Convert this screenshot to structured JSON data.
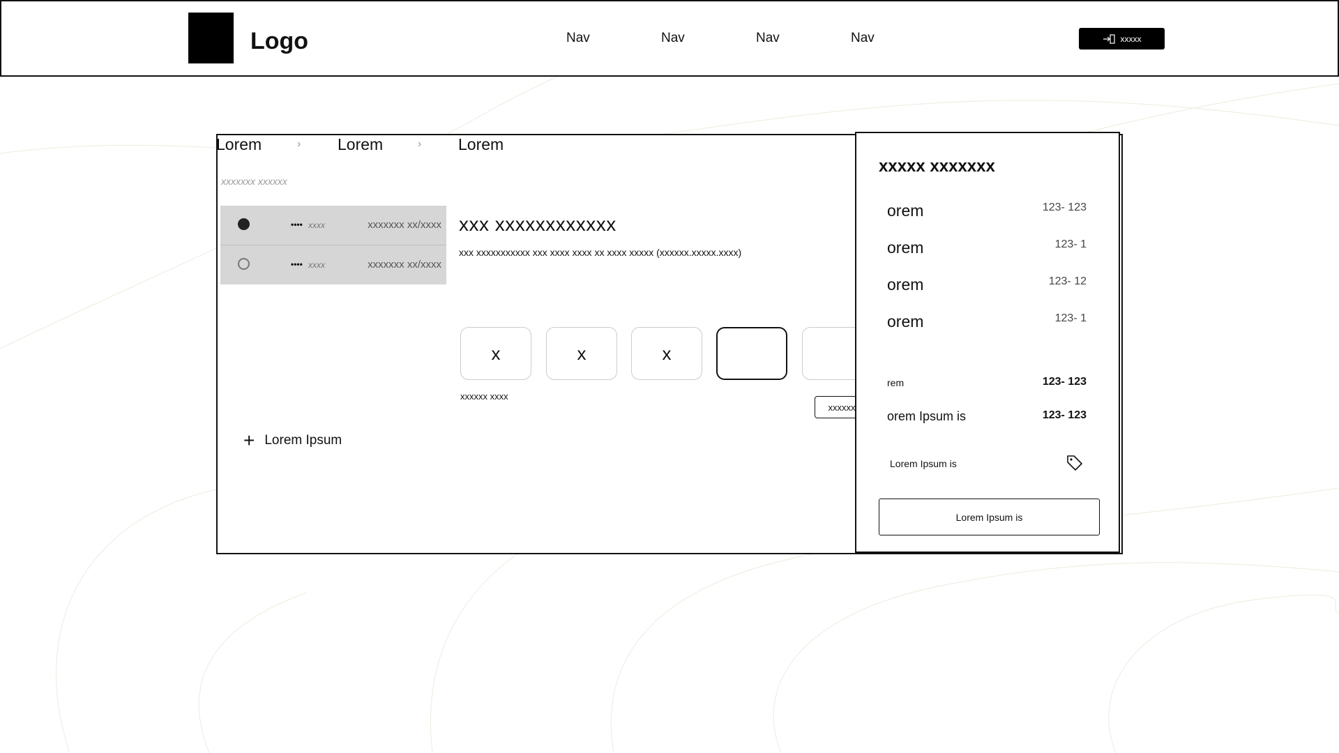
{
  "header": {
    "logo_text": "Logo",
    "nav": [
      "Nav",
      "Nav",
      "Nav",
      "Nav"
    ],
    "login_label": "xxxxx"
  },
  "breadcrumb": [
    "Lorem",
    "Lorem",
    "Lorem"
  ],
  "subtitle": "xxxxxxx xxxxxx",
  "cards": [
    {
      "dots": "••••",
      "number": "xxxx",
      "expiry": "xxxxxxx xx/xxxx",
      "selected": true
    },
    {
      "dots": "••••",
      "number": "xxxx",
      "expiry": "xxxxxxx xx/xxxx",
      "selected": false
    }
  ],
  "add_label": "Lorem Ipsum",
  "otp": {
    "title": "xxx xxxxxxxxxxxx",
    "description": "xxx xxxxxxxxxxx xxx xxxx xxxx xx xxxx xxxxx (xxxxxx.xxxxx.xxxx)",
    "digits": [
      "x",
      "x",
      "x",
      "",
      ""
    ],
    "hint": "xxxxxx xxxx",
    "resend_label": "xxxxxx"
  },
  "summary": {
    "title": "xxxxx xxxxxxx",
    "items": [
      {
        "label": "orem",
        "value": "123- 123"
      },
      {
        "label": "orem",
        "value": "123- 1"
      },
      {
        "label": "orem",
        "value": "123- 12"
      },
      {
        "label": "orem",
        "value": "123- 1"
      }
    ],
    "subtotal_label": "rem",
    "subtotal_value": "123- 123",
    "total_label": "orem Ipsum is",
    "total_value": "123- 123",
    "coupon_label": "Lorem Ipsum is",
    "confirm_label": "Lorem Ipsum is"
  },
  "colors": {
    "background": "#ffffff",
    "ink": "#111111",
    "card_bg": "#d6d6d6",
    "muted": "#999999"
  },
  "icons": [
    "login-icon",
    "chevron-right-icon",
    "plus-icon",
    "tag-icon",
    "radio-icon"
  ]
}
